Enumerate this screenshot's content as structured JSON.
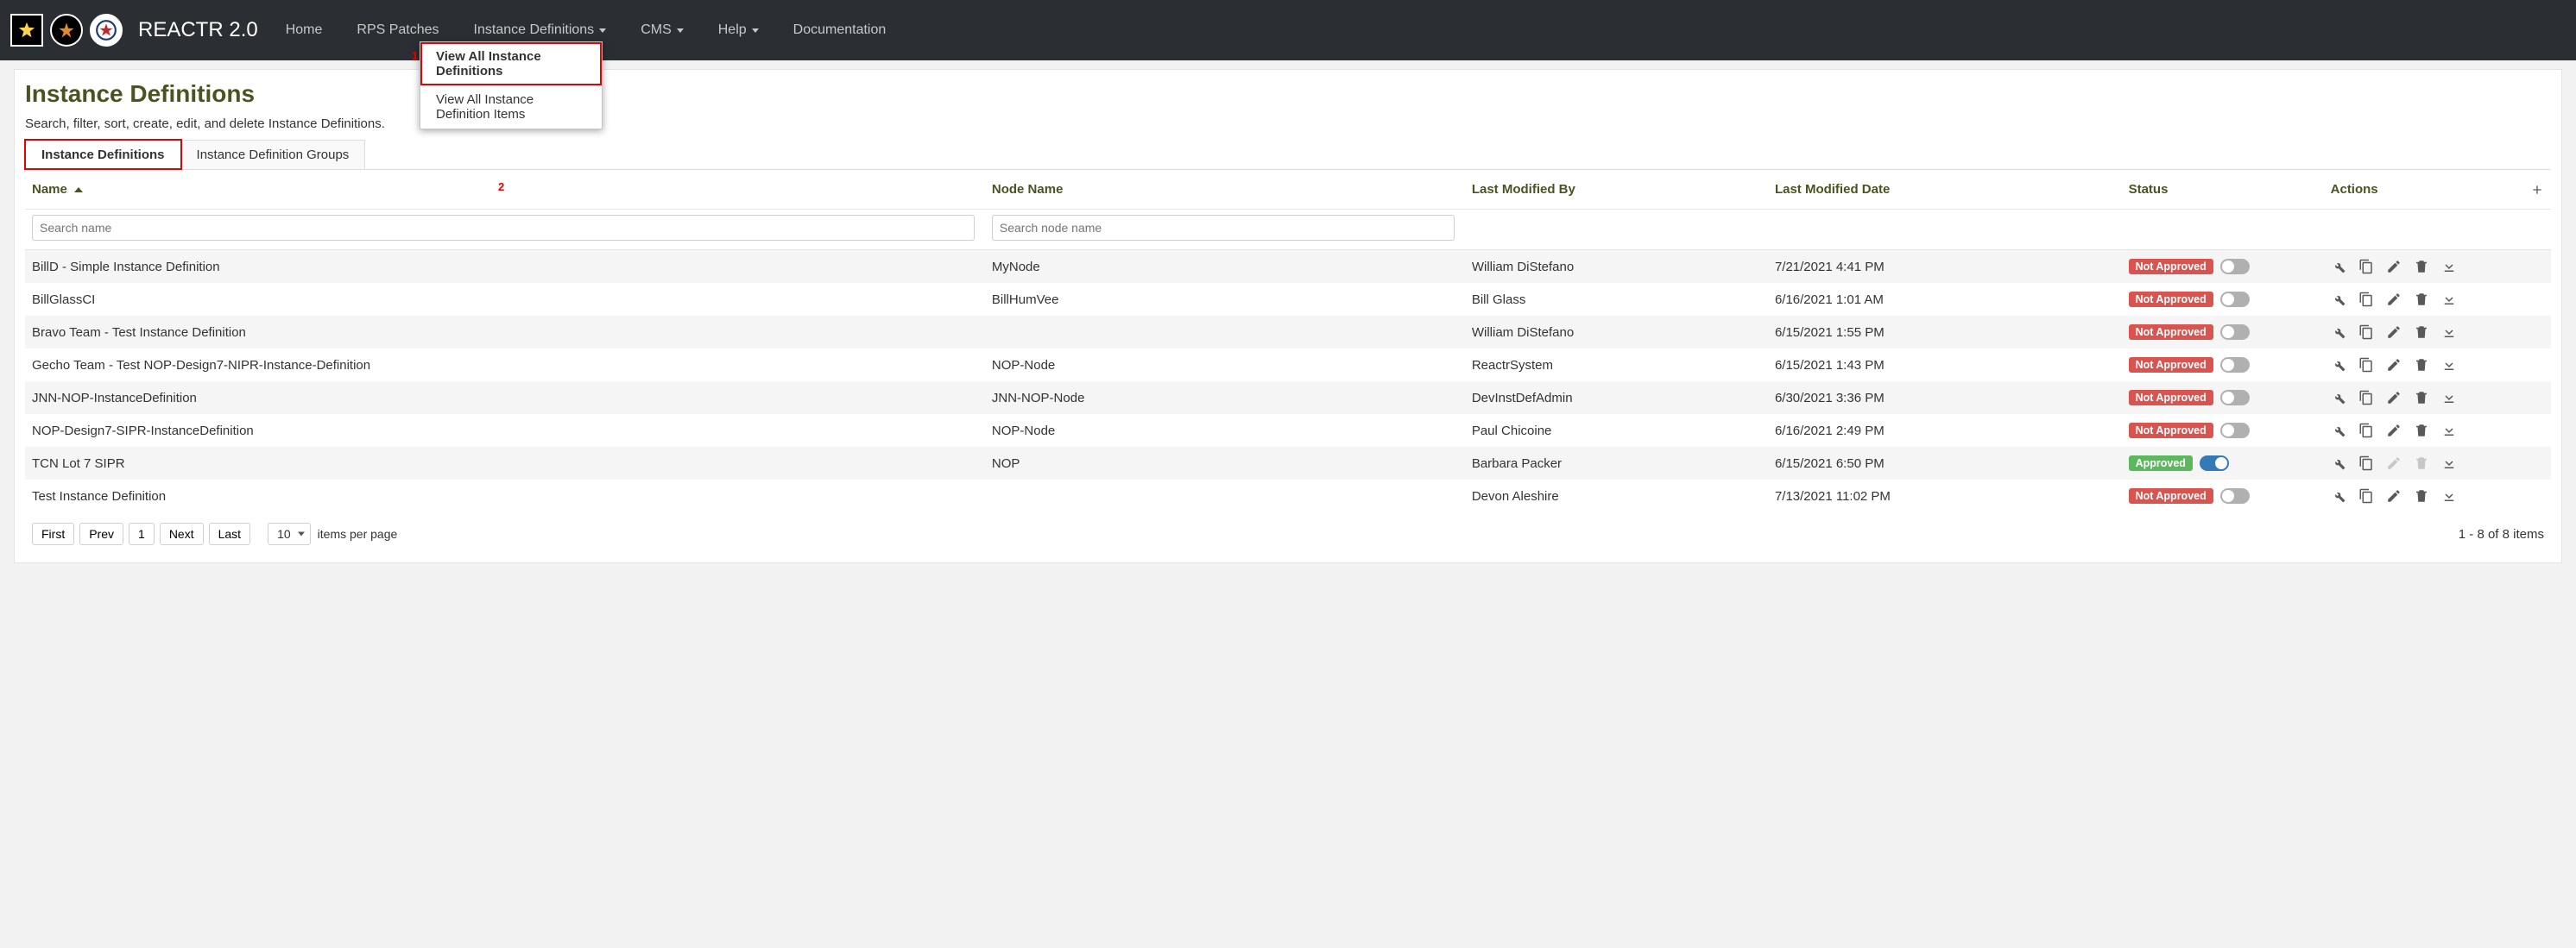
{
  "brand": "REACTR 2.0",
  "nav": {
    "home": "Home",
    "rps": "RPS Patches",
    "inst": "Instance Definitions",
    "cms": "CMS",
    "help": "Help",
    "docs": "Documentation"
  },
  "dropdown": {
    "view_all_defs": "View All Instance Definitions",
    "view_all_items": "View All Instance Definition Items"
  },
  "callouts": {
    "one": "1",
    "two": "2"
  },
  "page": {
    "title": "Instance Definitions",
    "subtitle": "Search, filter, sort, create, edit, and delete Instance Definitions."
  },
  "tabs": {
    "definitions": "Instance Definitions",
    "groups": "Instance Definition Groups"
  },
  "columns": {
    "name": "Name",
    "node": "Node Name",
    "modified_by": "Last Modified By",
    "modified_date": "Last Modified Date",
    "status": "Status",
    "actions": "Actions"
  },
  "filters": {
    "name_placeholder": "Search name",
    "node_placeholder": "Search node name"
  },
  "status_labels": {
    "approved": "Approved",
    "not_approved": "Not Approved"
  },
  "rows": [
    {
      "name": "BillD - Simple Instance Definition",
      "node": "MyNode",
      "by": "William DiStefano",
      "date": "7/21/2021 4:41 PM",
      "approved": false
    },
    {
      "name": "BillGlassCI",
      "node": "BillHumVee",
      "by": "Bill Glass",
      "date": "6/16/2021 1:01 AM",
      "approved": false
    },
    {
      "name": "Bravo Team - Test Instance Definition",
      "node": "",
      "by": "William DiStefano",
      "date": "6/15/2021 1:55 PM",
      "approved": false
    },
    {
      "name": "Gecho Team - Test NOP-Design7-NIPR-Instance-Definition",
      "node": "NOP-Node",
      "by": "ReactrSystem",
      "date": "6/15/2021 1:43 PM",
      "approved": false
    },
    {
      "name": "JNN-NOP-InstanceDefinition",
      "node": "JNN-NOP-Node",
      "by": "DevInstDefAdmin",
      "date": "6/30/2021 3:36 PM",
      "approved": false
    },
    {
      "name": "NOP-Design7-SIPR-InstanceDefinition",
      "node": "NOP-Node",
      "by": "Paul Chicoine",
      "date": "6/16/2021 2:49 PM",
      "approved": false
    },
    {
      "name": "TCN Lot 7 SIPR",
      "node": "NOP",
      "by": "Barbara Packer",
      "date": "6/15/2021 6:50 PM",
      "approved": true
    },
    {
      "name": "Test Instance Definition",
      "node": "",
      "by": "Devon Aleshire",
      "date": "7/13/2021 11:02 PM",
      "approved": false
    }
  ],
  "pager": {
    "first": "First",
    "prev": "Prev",
    "page": "1",
    "next": "Next",
    "last": "Last",
    "ipp_value": "10",
    "ipp_label": "items per page",
    "count": "1 - 8 of 8 items"
  }
}
